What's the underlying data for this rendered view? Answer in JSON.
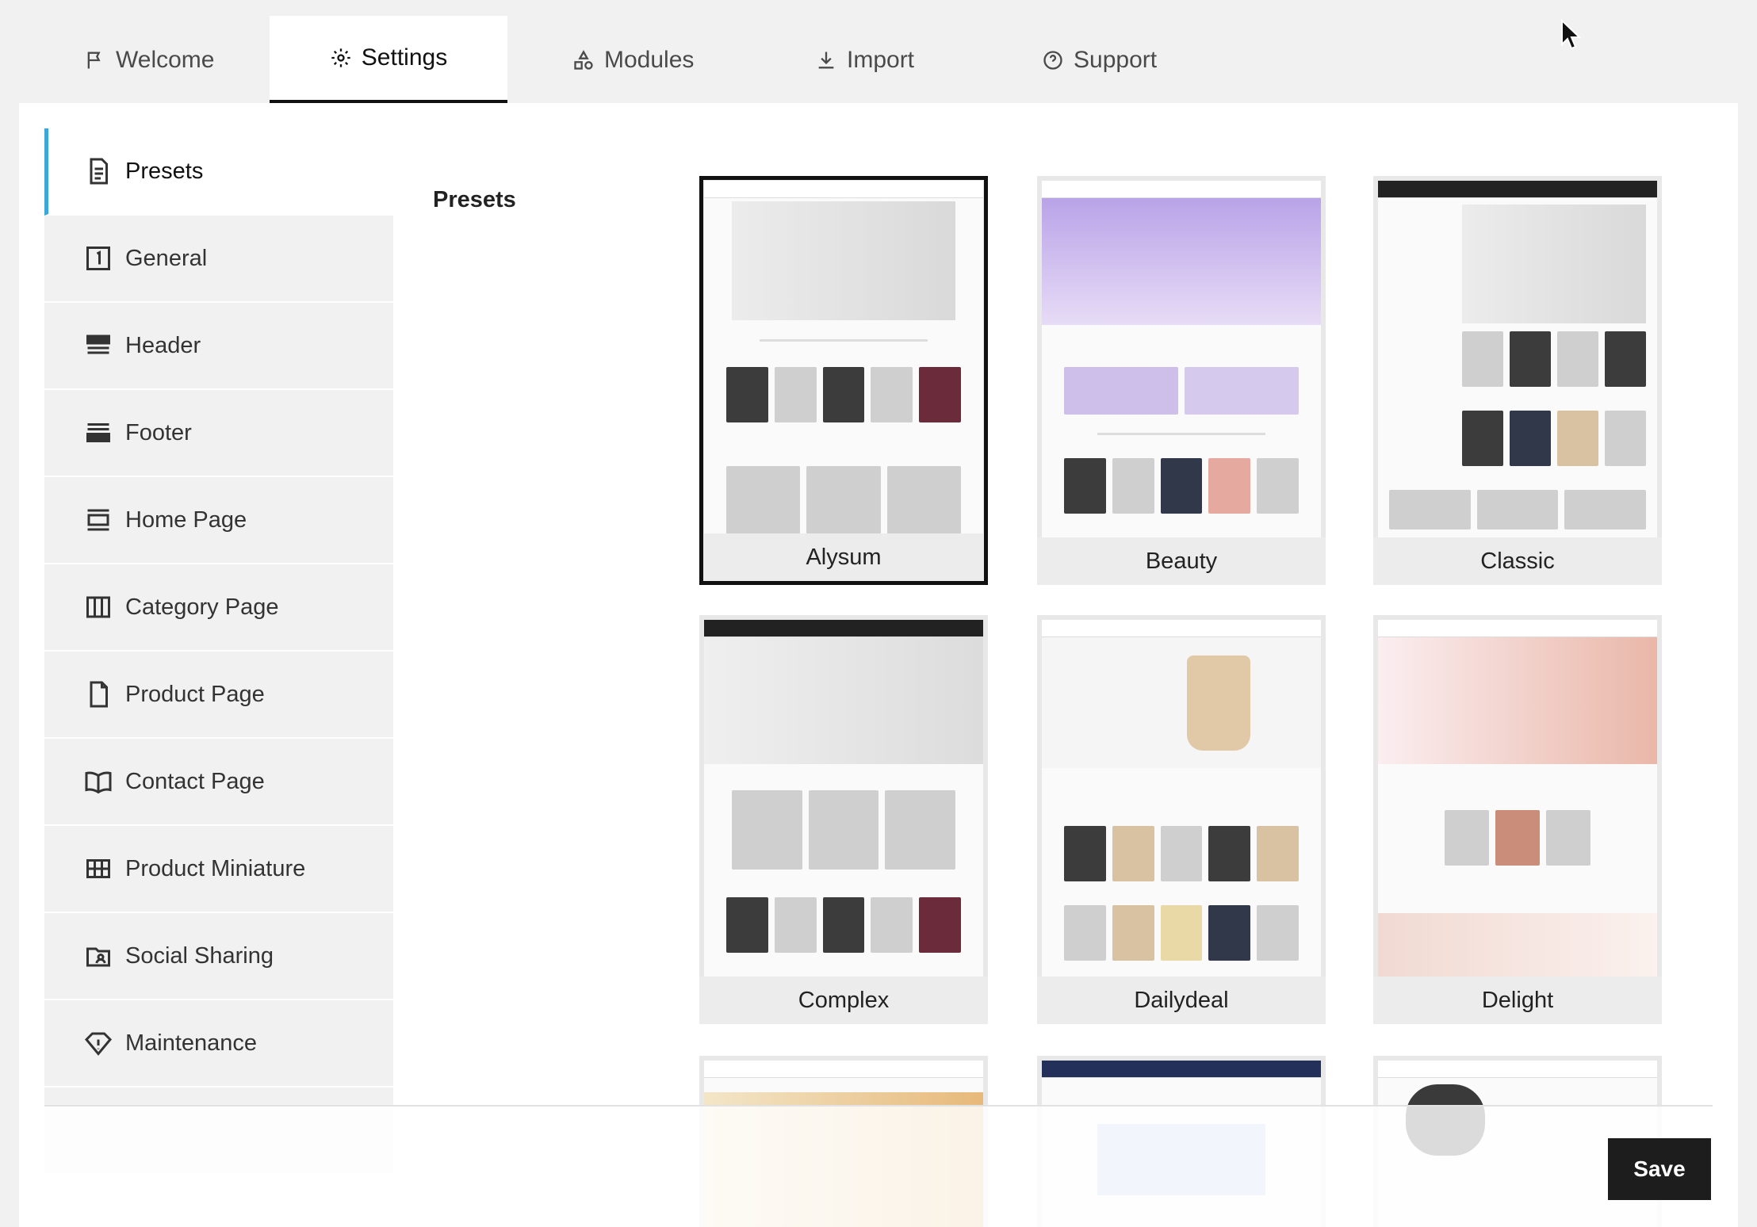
{
  "tabs": [
    {
      "label": "Welcome",
      "icon": "flag-icon"
    },
    {
      "label": "Settings",
      "icon": "gear-icon",
      "active": true
    },
    {
      "label": "Modules",
      "icon": "shapes-icon"
    },
    {
      "label": "Import",
      "icon": "download-icon"
    },
    {
      "label": "Support",
      "icon": "help-circle-icon"
    }
  ],
  "sidebar": {
    "items": [
      {
        "label": "Presets",
        "icon": "document-icon",
        "active": true
      },
      {
        "label": "General",
        "icon": "number-one-icon"
      },
      {
        "label": "Header",
        "icon": "header-icon"
      },
      {
        "label": "Footer",
        "icon": "footer-icon"
      },
      {
        "label": "Home Page",
        "icon": "home-layout-icon"
      },
      {
        "label": "Category Page",
        "icon": "columns-icon"
      },
      {
        "label": "Product Page",
        "icon": "page-icon"
      },
      {
        "label": "Contact Page",
        "icon": "book-icon"
      },
      {
        "label": "Product Miniature",
        "icon": "grid-icon"
      },
      {
        "label": "Social Sharing",
        "icon": "folder-user-icon"
      },
      {
        "label": "Maintenance",
        "icon": "diamond-icon"
      }
    ]
  },
  "main": {
    "section_title": "Presets",
    "presets": [
      {
        "name": "Alysum",
        "selected": true
      },
      {
        "name": "Beauty"
      },
      {
        "name": "Classic"
      },
      {
        "name": "Complex"
      },
      {
        "name": "Dailydeal"
      },
      {
        "name": "Delight"
      }
    ]
  },
  "footer": {
    "save_label": "Save"
  },
  "colors": {
    "accent": "#3aa7d8",
    "dark": "#1d1d1d"
  }
}
